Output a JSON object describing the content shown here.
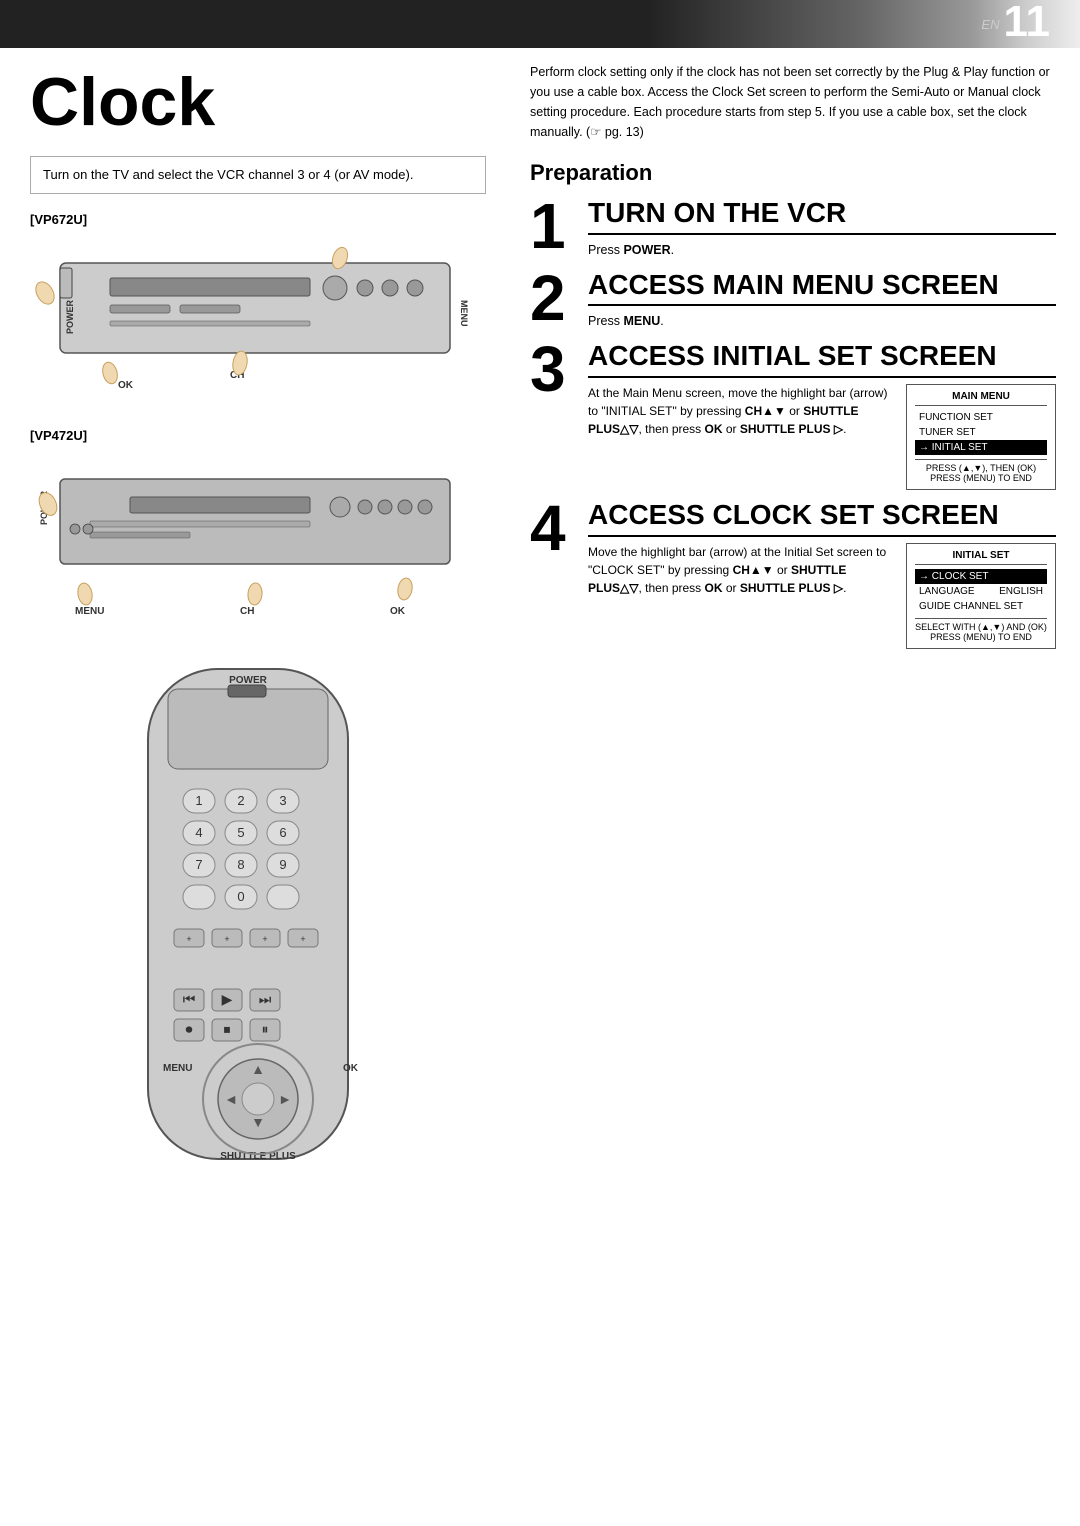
{
  "header": {
    "en_label": "EN",
    "page_number": "11"
  },
  "page_title": "Clock",
  "instruction_box": "Turn on the TV and select the VCR channel 3 or 4 (or AV mode).",
  "devices": [
    {
      "label": "[VP672U]"
    },
    {
      "label": "[VP472U]"
    }
  ],
  "right_top_text": "Perform clock setting only if the clock has not been set correctly by the Plug & Play function or you use a cable box. Access the Clock Set screen to perform the Semi-Auto or Manual clock setting procedure. Each procedure starts from step 5. If you use a cable box, set the clock manually. (☞ pg. 13)",
  "preparation_title": "Preparation",
  "steps": [
    {
      "number": "1",
      "title": "TURN ON THE VCR",
      "body": "Press POWER."
    },
    {
      "number": "2",
      "title": "ACCESS MAIN MENU SCREEN",
      "body": "Press MENU."
    },
    {
      "number": "3",
      "title": "ACCESS INITIAL SET SCREEN",
      "body": "At the Main Menu screen, move the highlight bar (arrow) to \"INITIAL SET\" by pressing CH▲▼ or SHUTTLE PLUS△▽, then press OK or SHUTTLE PLUS ▷.",
      "menu_title": "MAIN MENU",
      "menu_items": [
        "FUNCTION SET",
        "TUNER SET",
        "→ INITIAL SET"
      ],
      "highlighted_item": "→ INITIAL SET",
      "menu_footer": "PRESS (▲,▼), THEN (OK)\nPRESS (MENU) TO END"
    },
    {
      "number": "4",
      "title": "ACCESS CLOCK SET SCREEN",
      "body": "Move the highlight bar (arrow) at the Initial Set screen to \"CLOCK SET\" by pressing CH▲▼ or SHUTTLE PLUS△▽, then press OK or SHUTTLE PLUS ▷.",
      "menu_title": "INITIAL SET",
      "menu_items": [
        "→ CLOCK SET",
        "LANGUAGE",
        "GUIDE CHANNEL SET"
      ],
      "highlighted_item": "→ CLOCK SET",
      "menu_item_values": {
        "LANGUAGE": "ENGLISH"
      },
      "menu_footer": "SELECT WITH (▲,▼) AND (OK)\nPRESS (MENU) TO END"
    }
  ],
  "labels": {
    "power": "POWER",
    "menu": "MENU",
    "ok": "OK",
    "ch": "CH",
    "shuttle_plus": "SHUTTLE PLUS"
  }
}
